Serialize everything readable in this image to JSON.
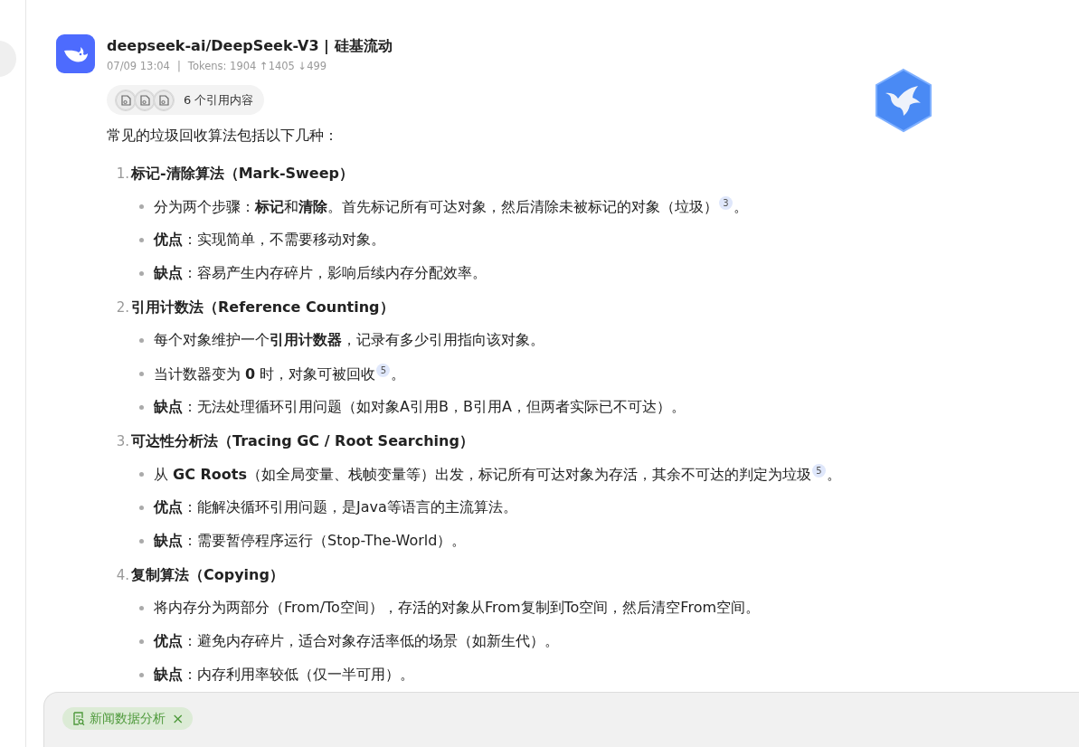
{
  "message": {
    "title": "deepseek-ai/DeepSeek-V3 | 硅基流动",
    "time": "07/09 13:04",
    "separator": "|",
    "tokens": "Tokens: 1904 ↑1405 ↓499",
    "references": {
      "label": "6 个引用内容"
    },
    "intro": "常见的垃圾回收算法包括以下几种：",
    "sections": [
      {
        "number": "1.",
        "heading": "标记-清除算法（Mark-Sweep）",
        "bullets": [
          {
            "text": "分为两个步骤：**标记**和**清除**。首先标记所有可达对象，然后清除未被标记的对象（垃圾）",
            "cite": "3",
            "tail": "。"
          },
          {
            "text": "**优点**：实现简单，不需要移动对象。"
          },
          {
            "text": "**缺点**：容易产生内存碎片，影响后续内存分配效率。"
          }
        ]
      },
      {
        "number": "2.",
        "heading": "引用计数法（Reference Counting）",
        "bullets": [
          {
            "text": "每个对象维护一个**引用计数器**，记录有多少引用指向该对象。"
          },
          {
            "text": "当计数器变为 **0** 时，对象可被回收",
            "cite": "5",
            "tail": "。"
          },
          {
            "text": "**缺点**：无法处理循环引用问题（如对象A引用B，B引用A，但两者实际已不可达）。"
          }
        ]
      },
      {
        "number": "3.",
        "heading": "可达性分析法（Tracing GC / Root Searching）",
        "bullets": [
          {
            "text": "从 **GC Roots**（如全局变量、栈帧变量等）出发，标记所有可达对象为存活，其余不可达的判定为垃圾",
            "cite": "5",
            "tail": "。"
          },
          {
            "text": "**优点**：能解决循环引用问题，是Java等语言的主流算法。"
          },
          {
            "text": "**缺点**：需要暂停程序运行（Stop-The-World）。"
          }
        ]
      },
      {
        "number": "4.",
        "heading": "复制算法（Copying）",
        "bullets": [
          {
            "text": "将内存分为两部分（From/To空间），存活的对象从From复制到To空间，然后清空From空间。"
          },
          {
            "text": "**优点**：避免内存碎片，适合对象存活率低的场景（如新生代）。"
          },
          {
            "text": "**缺点**：内存利用率较低（仅一半可用）。"
          }
        ]
      }
    ]
  },
  "composer": {
    "chip": {
      "label": "新闻数据分析",
      "close": "×"
    }
  }
}
